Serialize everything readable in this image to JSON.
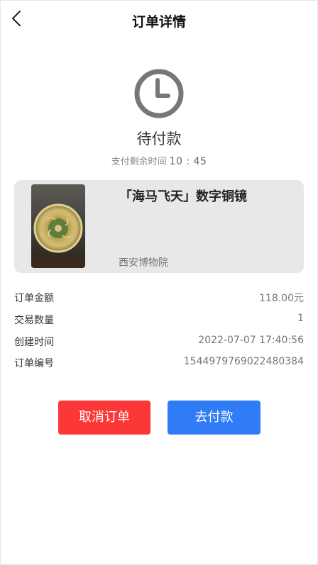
{
  "header": {
    "title": "订单详情"
  },
  "status": {
    "icon": "clock-icon",
    "text": "待付款",
    "remaining_label": "支付剩余时间",
    "remaining_time": "10 : 45"
  },
  "product": {
    "name": "「海马飞天」数字铜镜",
    "museum": "西安博物院"
  },
  "details": [
    {
      "label": "订单金额",
      "value": "118.00元"
    },
    {
      "label": "交易数量",
      "value": "1"
    },
    {
      "label": "创建时间",
      "value": "2022-07-07 17:40:56"
    },
    {
      "label": "订单编号",
      "value": "1544979769022480384"
    }
  ],
  "actions": {
    "cancel_label": "取消订单",
    "pay_label": "去付款"
  },
  "colors": {
    "cancel_button": "#fb3737",
    "pay_button": "#2f7cf6",
    "card_background": "#e8e8e8",
    "clock_icon": "#777777"
  }
}
